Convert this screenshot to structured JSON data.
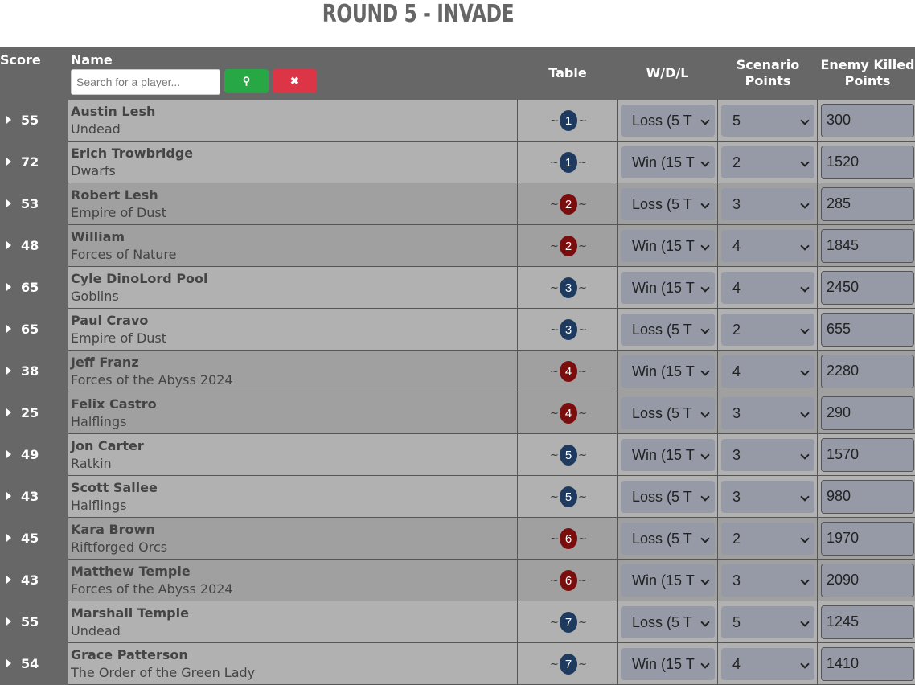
{
  "page": {
    "title": "ROUND 5 - INVADE"
  },
  "header": {
    "score": "Score",
    "name": "Name",
    "table": "Table",
    "wdl": "W/D/L",
    "scenario_line1": "Scenario",
    "scenario_line2": "Points",
    "enemy_line1": "Enemy Killed",
    "enemy_line2": "Points",
    "search_placeholder": "Search for a player...",
    "search_icon": "⚲",
    "clear_icon": "✖"
  },
  "colors": {
    "table_blue": "#1f3a5f",
    "table_red": "#7a0e0e",
    "search_green": "#28a745",
    "clear_red": "#dc3545"
  },
  "rows": [
    {
      "score": "55",
      "name": "Austin Lesh",
      "faction": "Undead",
      "table": "1",
      "wdl": "Loss (5 T",
      "scenario": "5",
      "enemy": "300"
    },
    {
      "score": "72",
      "name": "Erich Trowbridge",
      "faction": "Dwarfs",
      "table": "1",
      "wdl": "Win (15 T",
      "scenario": "2",
      "enemy": "1520"
    },
    {
      "score": "53",
      "name": "Robert Lesh",
      "faction": "Empire of Dust",
      "table": "2",
      "wdl": "Loss (5 T",
      "scenario": "3",
      "enemy": "285"
    },
    {
      "score": "48",
      "name": "William",
      "faction": "Forces of Nature",
      "table": "2",
      "wdl": "Win (15 T",
      "scenario": "4",
      "enemy": "1845"
    },
    {
      "score": "65",
      "name": "Cyle DinoLord Pool",
      "faction": "Goblins",
      "table": "3",
      "wdl": "Win (15 T",
      "scenario": "4",
      "enemy": "2450"
    },
    {
      "score": "65",
      "name": "Paul Cravo",
      "faction": "Empire of Dust",
      "table": "3",
      "wdl": "Loss (5 T",
      "scenario": "2",
      "enemy": "655"
    },
    {
      "score": "38",
      "name": "Jeff Franz",
      "faction": "Forces of the Abyss 2024",
      "table": "4",
      "wdl": "Win (15 T",
      "scenario": "4",
      "enemy": "2280"
    },
    {
      "score": "25",
      "name": "Felix Castro",
      "faction": "Halflings",
      "table": "4",
      "wdl": "Loss (5 T",
      "scenario": "3",
      "enemy": "290"
    },
    {
      "score": "49",
      "name": "Jon Carter",
      "faction": "Ratkin",
      "table": "5",
      "wdl": "Win (15 T",
      "scenario": "3",
      "enemy": "1570"
    },
    {
      "score": "43",
      "name": "Scott Sallee",
      "faction": "Halflings",
      "table": "5",
      "wdl": "Loss (5 T",
      "scenario": "3",
      "enemy": "980"
    },
    {
      "score": "45",
      "name": "Kara Brown",
      "faction": "Riftforged Orcs",
      "table": "6",
      "wdl": "Loss (5 T",
      "scenario": "2",
      "enemy": "1970"
    },
    {
      "score": "43",
      "name": "Matthew Temple",
      "faction": "Forces of the Abyss 2024",
      "table": "6",
      "wdl": "Win (15 T",
      "scenario": "3",
      "enemy": "2090"
    },
    {
      "score": "55",
      "name": "Marshall Temple",
      "faction": "Undead",
      "table": "7",
      "wdl": "Loss (5 T",
      "scenario": "5",
      "enemy": "1245"
    },
    {
      "score": "54",
      "name": "Grace Patterson",
      "faction": "The Order of the Green Lady",
      "table": "7",
      "wdl": "Win (15 T",
      "scenario": "4",
      "enemy": "1410"
    }
  ]
}
